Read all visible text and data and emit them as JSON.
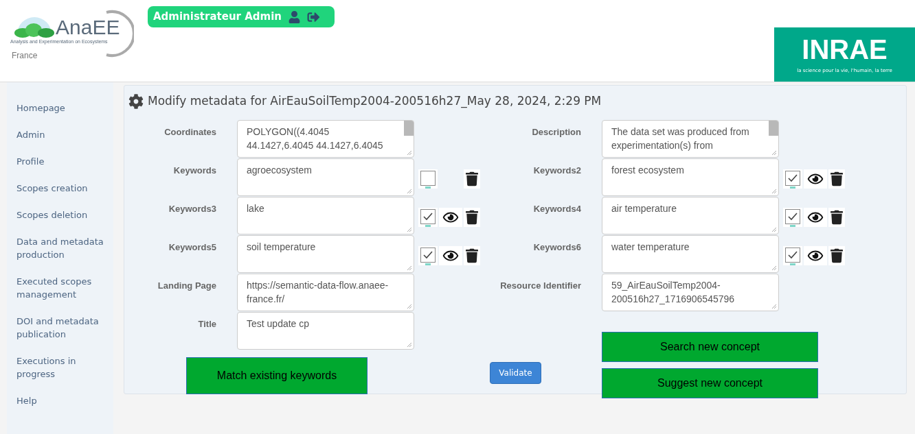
{
  "header": {
    "logo": {
      "name": "AnaEE",
      "tagline": "Analysis and Experimentation on Ecosystems",
      "country": "France"
    },
    "user": {
      "label": "Administrateur Admin"
    },
    "partner_logo": {
      "name": "INRAE",
      "tagline": "la science pour la vie, l'humain, la terre"
    }
  },
  "sidebar": {
    "items": [
      {
        "label": "Homepage",
        "selected": false
      },
      {
        "label": "Admin",
        "selected": false
      },
      {
        "label": "Profile",
        "selected": false
      },
      {
        "label": "Scopes creation",
        "selected": false
      },
      {
        "label": "Scopes deletion",
        "selected": false
      },
      {
        "label": "Data and metadata production",
        "selected": false
      },
      {
        "label": "Executed scopes management",
        "selected": false
      },
      {
        "label": "DOI and metadata publication",
        "selected": false
      },
      {
        "label": "Executions in progress",
        "selected": false
      },
      {
        "label": "Help",
        "selected": false
      }
    ]
  },
  "form": {
    "title": "Modify metadata for AirEauSoilTemp2004-200516h27_May 28, 2024, 2:29 PM",
    "left_fields": [
      {
        "kind": "text",
        "label": "Coordinates",
        "value": "POLYGON((4.4045 44.1427,6.4045 44.1427,6.4045",
        "scrollable": true
      },
      {
        "kind": "keyword",
        "label": "Keywords",
        "value": "agroecosystem",
        "checked": false
      },
      {
        "kind": "keyword",
        "label": "Keywords3",
        "value": "lake",
        "checked": true
      },
      {
        "kind": "keyword",
        "label": "Keywords5",
        "value": "soil temperature",
        "checked": true
      },
      {
        "kind": "text",
        "label": "Landing Page",
        "value": "https://semantic-data-flow.anaee-france.fr/",
        "scrollable": false
      },
      {
        "kind": "text",
        "label": "Title",
        "value": "Test update cp",
        "scrollable": false
      }
    ],
    "right_fields": [
      {
        "kind": "text",
        "label": "Description",
        "value": "The data set was produced from experimentation(s) from",
        "scrollable": true
      },
      {
        "kind": "keyword",
        "label": "Keywords2",
        "value": "forest ecosystem",
        "checked": true
      },
      {
        "kind": "keyword",
        "label": "Keywords4",
        "value": "air temperature",
        "checked": true
      },
      {
        "kind": "keyword",
        "label": "Keywords6",
        "value": "water temperature",
        "checked": true
      },
      {
        "kind": "text",
        "label": "Resource Identifier",
        "value": "59_AirEauSoilTemp2004-200516h27_1716906545796",
        "scrollable": false
      }
    ],
    "buttons": {
      "match": "Match existing keywords",
      "validate": "Validate",
      "search": "Search new concept",
      "suggest": "Suggest new concept"
    }
  }
}
